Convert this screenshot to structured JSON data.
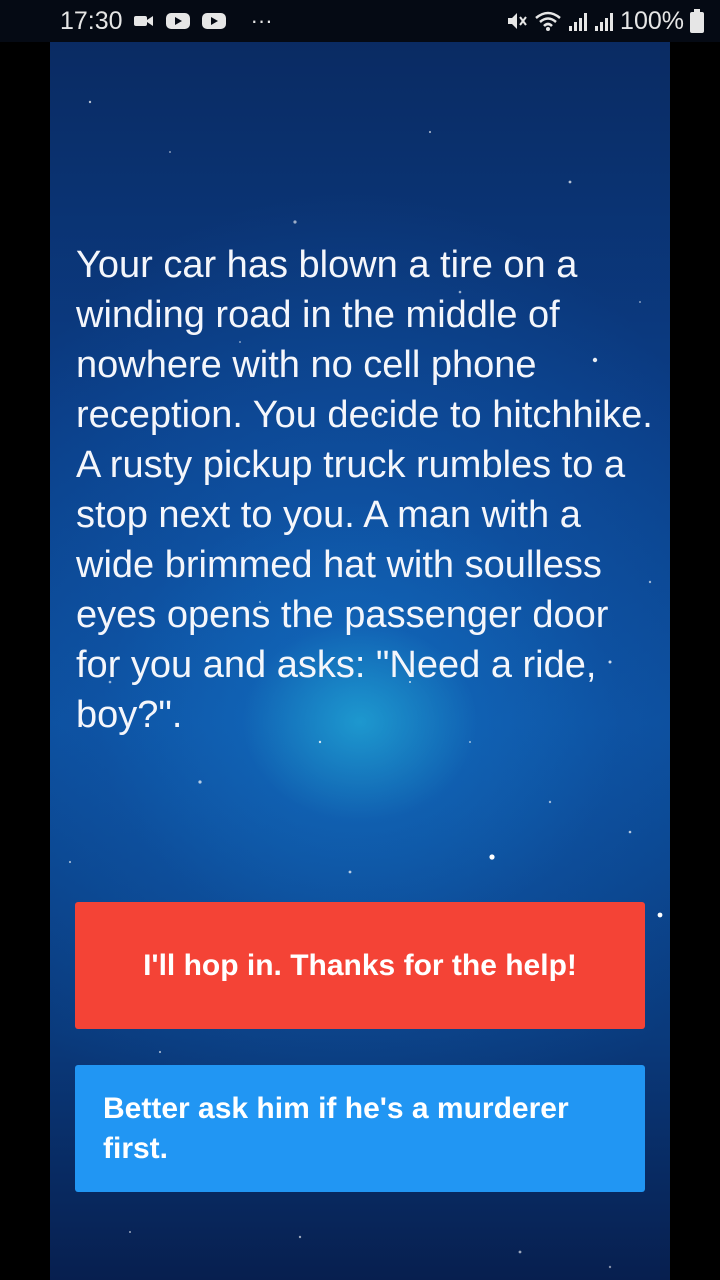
{
  "status_bar": {
    "time": "17:30",
    "more": "···",
    "battery": "100%"
  },
  "story": {
    "text": "Your car has blown a tire on a winding road in the middle of nowhere with no cell phone reception. You decide to hitchhike. A rusty pickup truck rumbles to a stop next to you. A man with a wide brimmed hat with soulless eyes opens the passenger door for you and asks: \"Need a ride, boy?\"."
  },
  "choices": [
    {
      "label": "I'll hop in. Thanks for the help!",
      "color": "#f44336"
    },
    {
      "label": "Better ask him if he's a murderer first.",
      "color": "#2196f3"
    }
  ]
}
